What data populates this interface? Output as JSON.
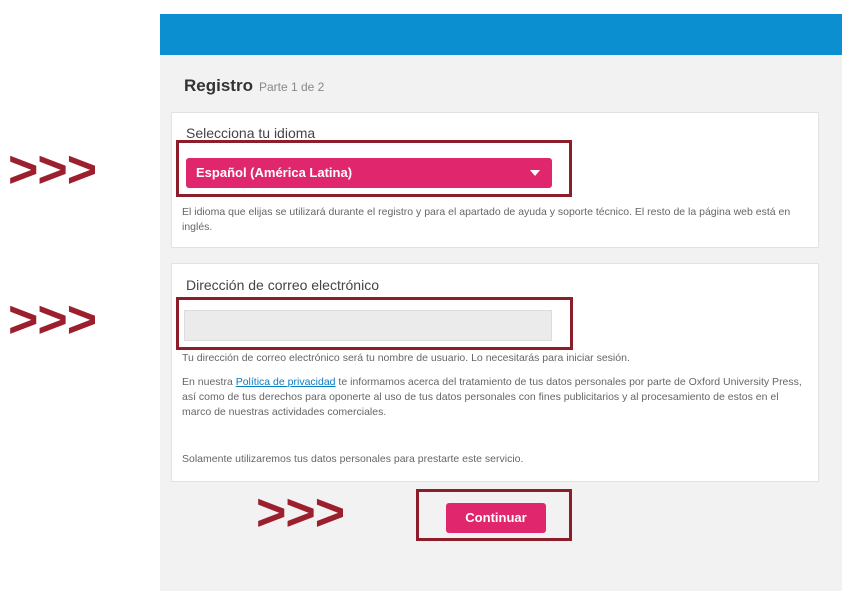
{
  "header": {
    "title": "Registro",
    "step": "Parte 1 de 2"
  },
  "language": {
    "label": "Selecciona tu idioma",
    "selected": "Español (América Latina)",
    "help": "El idioma que elijas se utilizará durante el registro y para el apartado de ayuda y soporte técnico. El resto de la página web está en inglés."
  },
  "email": {
    "label": "Dirección de correo electrónico",
    "value": "",
    "help1": "Tu dirección de correo electrónico será tu nombre de usuario. Lo necesitarás para iniciar sesión.",
    "privacy_prefix": "En nuestra ",
    "privacy_link": "Política de privacidad",
    "privacy_suffix": " te informamos acerca del tratamiento de tus datos personales por parte de Oxford University Press, así como de tus derechos para oponerte al uso de tus datos personales con fines publicitarios y al procesamiento de estos en el marco de nuestras actividades comerciales.",
    "help3": "Solamente utilizaremos tus datos personales para prestarte este servicio."
  },
  "actions": {
    "continue_label": "Continuar"
  },
  "annotations": {
    "arrow_text": ">>>"
  },
  "colors": {
    "accent": "#e0276d",
    "topbar": "#0b8fd0",
    "highlight": "#8c1d2b"
  }
}
